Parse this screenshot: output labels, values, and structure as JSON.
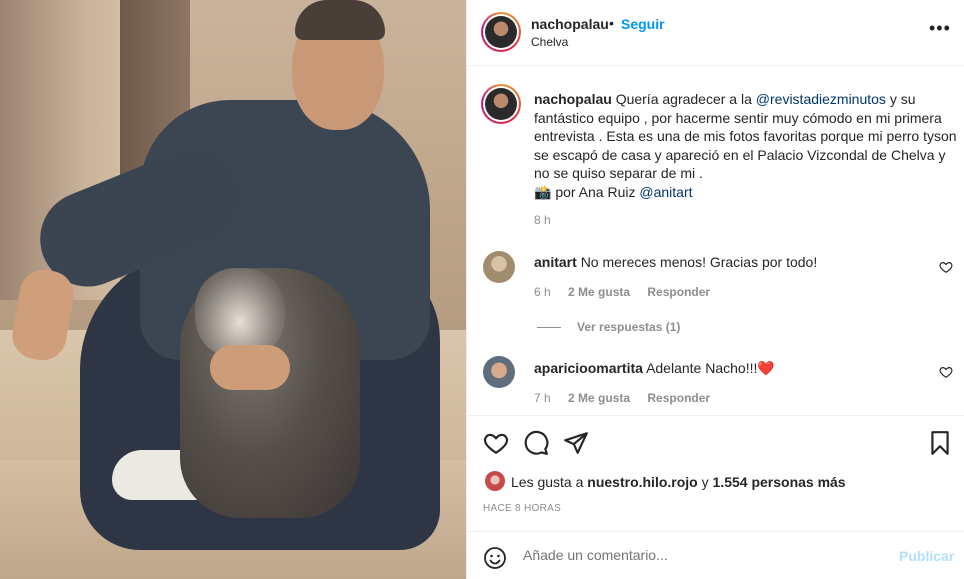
{
  "header": {
    "username": "nachopalau",
    "dot": "•",
    "follow": "Seguir",
    "location": "Chelva",
    "more": "•••"
  },
  "caption": {
    "username": "nachopalau",
    "t1": "Quería agradecer a la ",
    "mention1": "@revistadiezminutos",
    "t2": " y su fantástico equipo , por hacerme sentir muy cómodo en mi primera entrevista . Esta es una de mis fotos favoritas porque mi perro tyson se escapó de casa y apareció en el Palacio Vizcondal de Chelva y no se quiso separar de mi .",
    "camera": "📸",
    "t3": " por Ana Ruiz ",
    "mention2": "@anitart",
    "time": "8 h"
  },
  "comments": [
    {
      "username": "anitart",
      "text": "No mereces menos! Gracias por todo!",
      "time": "6 h",
      "likes": "2 Me gusta",
      "reply": "Responder",
      "view_replies": "Ver respuestas (1)"
    },
    {
      "username": "aparicioomartita",
      "text": "Adelante Nacho!!!",
      "emoji": "❤️",
      "time": "7 h",
      "likes": "2 Me gusta",
      "reply": "Responder"
    }
  ],
  "likes": {
    "prefix": "Les gusta a ",
    "user": "nuestro.hilo.rojo",
    "mid": " y ",
    "count": "1.554 personas más"
  },
  "ago": "HACE 8 HORAS",
  "comment_box": {
    "placeholder": "Añade un comentario...",
    "publish": "Publicar"
  },
  "colors": {
    "accent": "#0095f6",
    "mention": "#00376b",
    "heart": "#ed4956"
  },
  "icons": [
    "heart-icon",
    "comment-icon",
    "share-icon",
    "save-icon",
    "emoji-icon",
    "more-icon"
  ]
}
